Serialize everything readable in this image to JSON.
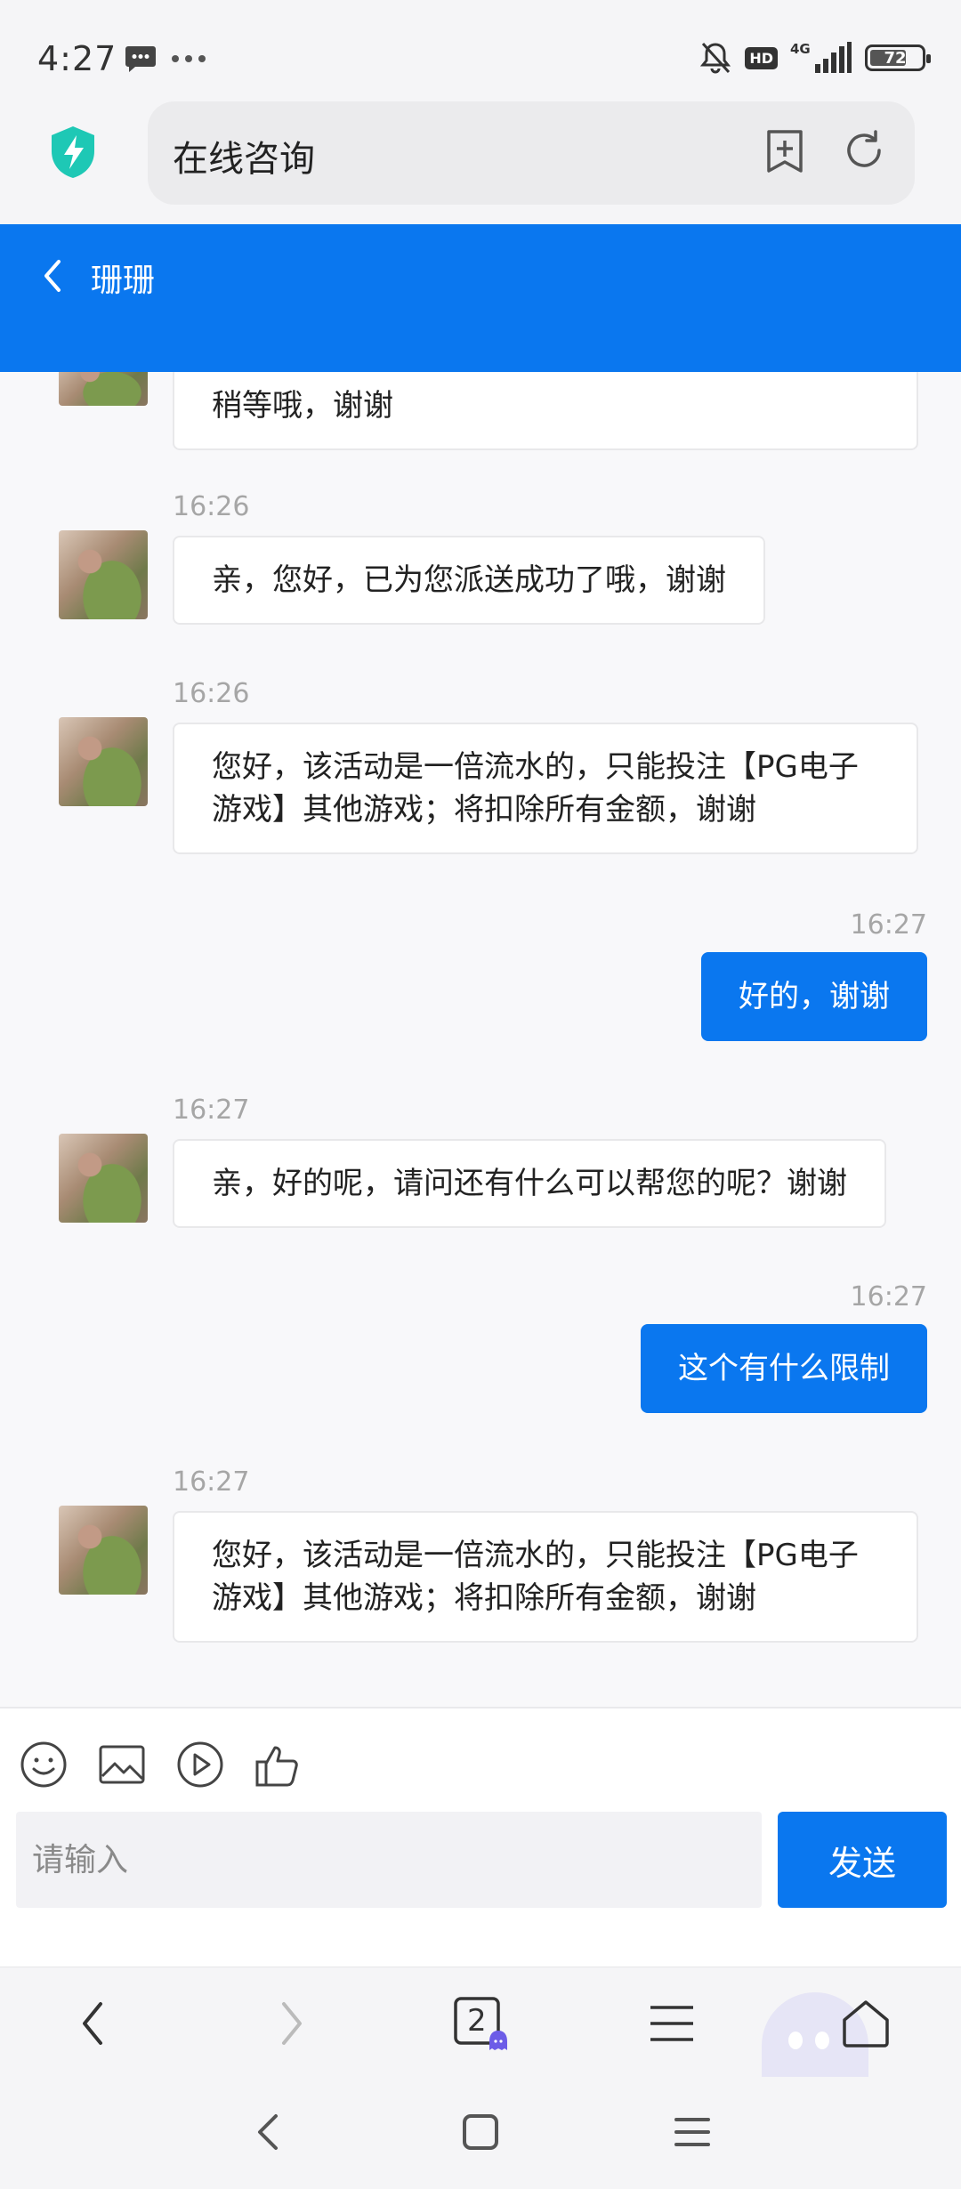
{
  "status_bar": {
    "time": "4:27",
    "network": "4G",
    "hd_badge": "HD",
    "battery": "72",
    "battery_level": 0.72,
    "icons": [
      "message-icon",
      "more-icon",
      "bell-muted-icon",
      "hd-icon",
      "signal-icon",
      "battery-icon"
    ]
  },
  "browser": {
    "page_title": "在线咨询",
    "icons": [
      "shield-icon",
      "bookmark-add-icon",
      "refresh-icon"
    ]
  },
  "chat": {
    "agent_name": "珊珊",
    "accent_color": "#0a77ef",
    "messages": [
      {
        "side": "left",
        "time": "",
        "text": "稍等哦，谢谢"
      },
      {
        "side": "left",
        "time": "16:26",
        "text": "亲，您好，已为您派送成功了哦，谢谢"
      },
      {
        "side": "left",
        "time": "16:26",
        "line1": "您好，该活动是一倍流水的，只能投注【PG电子",
        "line2": "游戏】其他游戏；将扣除所有金额，谢谢"
      },
      {
        "side": "right",
        "time": "16:27",
        "text": "好的，谢谢"
      },
      {
        "side": "left",
        "time": "16:27",
        "text": "亲，好的呢，请问还有什么可以帮您的呢？谢谢"
      },
      {
        "side": "right",
        "time": "16:27",
        "text": "这个有什么限制"
      },
      {
        "side": "left",
        "time": "16:27",
        "line1": "您好，该活动是一倍流水的，只能投注【PG电子",
        "line2": "游戏】其他游戏；将扣除所有金额，谢谢"
      }
    ]
  },
  "composer": {
    "placeholder": "请输入",
    "send_label": "发送",
    "tools": [
      "emoji-icon",
      "image-icon",
      "video-icon",
      "thumbs-up-icon"
    ]
  },
  "browser_nav": {
    "tab_count": "2"
  }
}
